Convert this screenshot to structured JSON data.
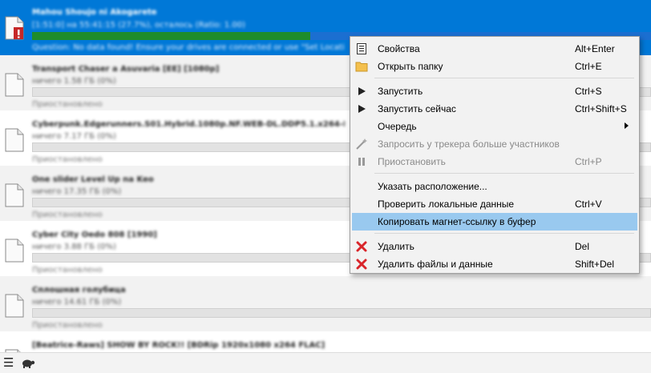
{
  "torrents": [
    {
      "name": "Mahou Shoujo ni Akogarete",
      "status": "[1:51:0] на 55:41:15 (27.7%), осталось (Ratio: 1.00)",
      "subtext": "Question: No data found! Ensure your drives are connected or use \"Set Location\"",
      "progress": 0.45,
      "selected": true,
      "error": true
    },
    {
      "name": "Transport Chaser a Asuvaria [EE] [1080p]",
      "status": "ничего 1.58 ГБ (0%)",
      "subtext": "Приостановлено",
      "progress": 0.0,
      "selected": false,
      "error": false
    },
    {
      "name": "Cyberpunk.Edgerunners.S01.Hybrid.1080p.NF.WEB-DL.DDP5.1.x264-ISA",
      "status": "ничего 7.17 ГБ (0%)",
      "subtext": "Приостановлено",
      "progress": 0.0,
      "selected": false,
      "error": false
    },
    {
      "name": "One slider Level Up na Keo",
      "status": "ничего 17.35 ГБ (0%)",
      "subtext": "Приостановлено",
      "progress": 0.0,
      "selected": false,
      "error": false
    },
    {
      "name": "Cyber City Oedo 808 [1990]",
      "status": "ничего 3.88 ГБ (0%)",
      "subtext": "Приостановлено",
      "progress": 0.0,
      "selected": false,
      "error": false
    },
    {
      "name": "Сплошная голубица",
      "status": "ничего 14.61 ГБ (0%)",
      "subtext": "Приостановлено",
      "progress": 0.0,
      "selected": false,
      "error": false
    },
    {
      "name": "[Beatrice-Raws] SHOW BY ROCK!! [BDRip 1920x1080 x264 FLAC]",
      "status": "",
      "subtext": "",
      "progress": 0.0,
      "selected": false,
      "error": false
    }
  ],
  "context_menu": {
    "items": [
      {
        "label": "Свойства",
        "shortcut": "Alt+Enter",
        "icon": "properties-icon",
        "disabled": false,
        "highlighted": false
      },
      {
        "label": "Открыть папку",
        "shortcut": "Ctrl+E",
        "icon": "folder-icon",
        "disabled": false,
        "highlighted": false
      },
      {
        "label": "Запустить",
        "shortcut": "Ctrl+S",
        "icon": "play-icon",
        "disabled": false,
        "highlighted": false
      },
      {
        "label": "Запустить сейчас",
        "shortcut": "Ctrl+Shift+S",
        "icon": "play-icon",
        "disabled": false,
        "highlighted": false
      },
      {
        "label": "Очередь",
        "shortcut": "",
        "icon": "",
        "disabled": false,
        "highlighted": false,
        "submenu": true
      },
      {
        "label": "Запросить у трекера больше участников",
        "shortcut": "",
        "icon": "magic-wand-icon",
        "disabled": true,
        "highlighted": false
      },
      {
        "label": "Приостановить",
        "shortcut": "Ctrl+P",
        "icon": "pause-icon",
        "disabled": true,
        "highlighted": false
      },
      {
        "label": "Указать расположение...",
        "shortcut": "",
        "icon": "",
        "disabled": false,
        "highlighted": false
      },
      {
        "label": "Проверить локальные данные",
        "shortcut": "Ctrl+V",
        "icon": "",
        "disabled": false,
        "highlighted": false
      },
      {
        "label": "Копировать магнет-ссылку в буфер",
        "shortcut": "",
        "icon": "",
        "disabled": false,
        "highlighted": true
      },
      {
        "label": "Удалить",
        "shortcut": "Del",
        "icon": "remove-icon",
        "disabled": false,
        "highlighted": false
      },
      {
        "label": "Удалить файлы и данные",
        "shortcut": "Shift+Del",
        "icon": "remove-icon",
        "disabled": false,
        "highlighted": false
      }
    ]
  },
  "statusbar": {
    "menu_icon": "hamburger-menu-icon",
    "speed_icon": "turtle-icon"
  },
  "colors": {
    "selection": "#0078d7",
    "progress": "#1e8c2c",
    "menu_highlight": "#99c9ef",
    "remove": "#d9252a"
  }
}
